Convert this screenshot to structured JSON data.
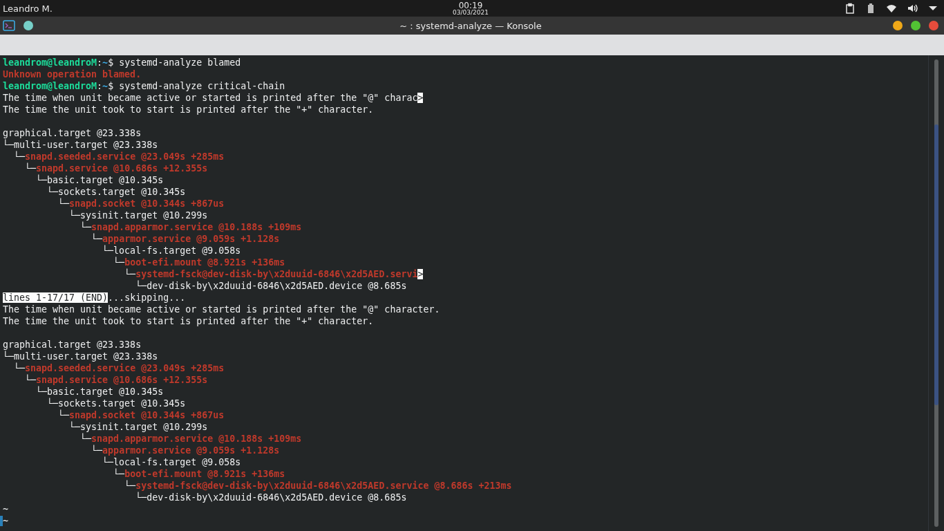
{
  "panel": {
    "user": "Leandro M.",
    "time": "00:19",
    "date": "03/03/2021"
  },
  "window": {
    "title": "~ : systemd-analyze — Konsole"
  },
  "terminal": {
    "lines": [
      {
        "segments": [
          {
            "kind": "user",
            "text": "leandrom@leandroM"
          },
          {
            "kind": "plain",
            "text": ":"
          },
          {
            "kind": "path",
            "text": "~"
          },
          {
            "kind": "plain",
            "text": "$ systemd-analyze blamed"
          }
        ]
      },
      {
        "segments": [
          {
            "kind": "error",
            "text": "Unknown operation blamed."
          }
        ]
      },
      {
        "segments": [
          {
            "kind": "user",
            "text": "leandrom@leandroM"
          },
          {
            "kind": "plain",
            "text": ":"
          },
          {
            "kind": "path",
            "text": "~"
          },
          {
            "kind": "plain",
            "text": "$ systemd-analyze critical-chain"
          }
        ]
      },
      {
        "segments": [
          {
            "kind": "plain",
            "text": "The time when unit became active or started is printed after the \"@\" charac"
          },
          {
            "kind": "inverse",
            "text": ">"
          }
        ]
      },
      {
        "segments": [
          {
            "kind": "plain",
            "text": "The time the unit took to start is printed after the \"+\" character."
          }
        ]
      },
      {
        "kind": "blank"
      },
      {
        "segments": [
          {
            "kind": "plain",
            "text": "graphical.target @23.338s"
          }
        ]
      },
      {
        "segments": [
          {
            "kind": "plain",
            "text": "└─multi-user.target @23.338s"
          }
        ]
      },
      {
        "segments": [
          {
            "kind": "plain",
            "text": "  └─"
          },
          {
            "kind": "error",
            "text": "snapd.seeded.service @23.049s +285ms"
          }
        ]
      },
      {
        "segments": [
          {
            "kind": "plain",
            "text": "    └─"
          },
          {
            "kind": "error",
            "text": "snapd.service @10.686s +12.355s"
          }
        ]
      },
      {
        "segments": [
          {
            "kind": "plain",
            "text": "      └─basic.target @10.345s"
          }
        ]
      },
      {
        "segments": [
          {
            "kind": "plain",
            "text": "        └─sockets.target @10.345s"
          }
        ]
      },
      {
        "segments": [
          {
            "kind": "plain",
            "text": "          └─"
          },
          {
            "kind": "error",
            "text": "snapd.socket @10.344s +867us"
          }
        ]
      },
      {
        "segments": [
          {
            "kind": "plain",
            "text": "            └─sysinit.target @10.299s"
          }
        ]
      },
      {
        "segments": [
          {
            "kind": "plain",
            "text": "              └─"
          },
          {
            "kind": "error",
            "text": "snapd.apparmor.service @10.188s +109ms"
          }
        ]
      },
      {
        "segments": [
          {
            "kind": "plain",
            "text": "                └─"
          },
          {
            "kind": "error",
            "text": "apparmor.service @9.059s +1.128s"
          }
        ]
      },
      {
        "segments": [
          {
            "kind": "plain",
            "text": "                  └─local-fs.target @9.058s"
          }
        ]
      },
      {
        "segments": [
          {
            "kind": "plain",
            "text": "                    └─"
          },
          {
            "kind": "error",
            "text": "boot-efi.mount @8.921s +136ms"
          }
        ]
      },
      {
        "segments": [
          {
            "kind": "plain",
            "text": "                      └─"
          },
          {
            "kind": "error",
            "text": "systemd-fsck@dev-disk-by\\x2duuid-6846\\x2d5AED.servi"
          },
          {
            "kind": "inverse",
            "text": ">"
          }
        ]
      },
      {
        "segments": [
          {
            "kind": "plain",
            "text": "                        └─dev-disk-by\\x2duuid-6846\\x2d5AED.device @8.685s"
          }
        ]
      },
      {
        "segments": [
          {
            "kind": "inverse",
            "text": "lines 1-17/17 (END)"
          },
          {
            "kind": "plain",
            "text": "...skipping..."
          }
        ]
      },
      {
        "segments": [
          {
            "kind": "plain",
            "text": "The time when unit became active or started is printed after the \"@\" character."
          }
        ]
      },
      {
        "segments": [
          {
            "kind": "plain",
            "text": "The time the unit took to start is printed after the \"+\" character."
          }
        ]
      },
      {
        "kind": "blank"
      },
      {
        "segments": [
          {
            "kind": "plain",
            "text": "graphical.target @23.338s"
          }
        ]
      },
      {
        "segments": [
          {
            "kind": "plain",
            "text": "└─multi-user.target @23.338s"
          }
        ]
      },
      {
        "segments": [
          {
            "kind": "plain",
            "text": "  └─"
          },
          {
            "kind": "error",
            "text": "snapd.seeded.service @23.049s +285ms"
          }
        ]
      },
      {
        "segments": [
          {
            "kind": "plain",
            "text": "    └─"
          },
          {
            "kind": "error",
            "text": "snapd.service @10.686s +12.355s"
          }
        ]
      },
      {
        "segments": [
          {
            "kind": "plain",
            "text": "      └─basic.target @10.345s"
          }
        ]
      },
      {
        "segments": [
          {
            "kind": "plain",
            "text": "        └─sockets.target @10.345s"
          }
        ]
      },
      {
        "segments": [
          {
            "kind": "plain",
            "text": "          └─"
          },
          {
            "kind": "error",
            "text": "snapd.socket @10.344s +867us"
          }
        ]
      },
      {
        "segments": [
          {
            "kind": "plain",
            "text": "            └─sysinit.target @10.299s"
          }
        ]
      },
      {
        "segments": [
          {
            "kind": "plain",
            "text": "              └─"
          },
          {
            "kind": "error",
            "text": "snapd.apparmor.service @10.188s +109ms"
          }
        ]
      },
      {
        "segments": [
          {
            "kind": "plain",
            "text": "                └─"
          },
          {
            "kind": "error",
            "text": "apparmor.service @9.059s +1.128s"
          }
        ]
      },
      {
        "segments": [
          {
            "kind": "plain",
            "text": "                  └─local-fs.target @9.058s"
          }
        ]
      },
      {
        "segments": [
          {
            "kind": "plain",
            "text": "                    └─"
          },
          {
            "kind": "error",
            "text": "boot-efi.mount @8.921s +136ms"
          }
        ]
      },
      {
        "segments": [
          {
            "kind": "plain",
            "text": "                      └─"
          },
          {
            "kind": "error",
            "text": "systemd-fsck@dev-disk-by\\x2duuid-6846\\x2d5AED.service @8.686s +213ms"
          }
        ]
      },
      {
        "segments": [
          {
            "kind": "plain",
            "text": "                        └─dev-disk-by\\x2duuid-6846\\x2d5AED.device @8.685s"
          }
        ]
      },
      {
        "segments": [
          {
            "kind": "plain",
            "text": "~"
          }
        ]
      },
      {
        "cursor": true,
        "segments": [
          {
            "kind": "plain",
            "text": "~"
          }
        ]
      }
    ]
  }
}
